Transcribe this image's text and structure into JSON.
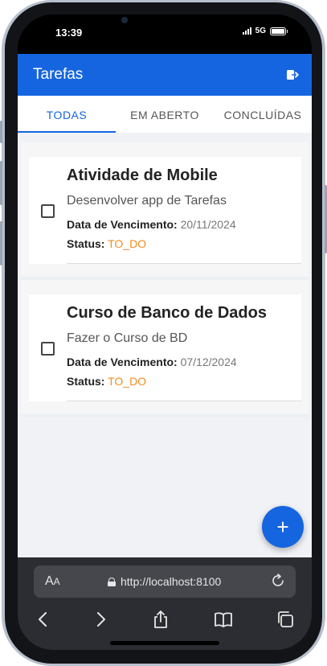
{
  "status_bar": {
    "time": "13:39",
    "network": "5G"
  },
  "app": {
    "title": "Tarefas",
    "accent_color": "#1565e0",
    "header_icon": "logout-icon"
  },
  "tabs": [
    {
      "label": "TODAS",
      "active": true
    },
    {
      "label": "EM ABERTO",
      "active": false
    },
    {
      "label": "CONCLUÍDAS",
      "active": false
    }
  ],
  "tasks": [
    {
      "title": "Atividade de Mobile",
      "description": "Desenvolver app de Tarefas",
      "due_label": "Data de Vencimento:",
      "due_value": "20/11/2024",
      "status_label": "Status:",
      "status_value": "TO_DO",
      "checked": false
    },
    {
      "title": "Curso de Banco de Dados",
      "description": "Fazer o Curso de BD",
      "due_label": "Data de Vencimento:",
      "due_value": "07/12/2024",
      "status_label": "Status:",
      "status_value": "TO_DO",
      "checked": false
    }
  ],
  "fab": {
    "icon": "plus-icon",
    "label": "+"
  },
  "browser": {
    "text_size_big": "A",
    "text_size_small": "A",
    "url": "http://localhost:8100",
    "nav_icons": [
      "back-icon",
      "forward-icon",
      "share-icon",
      "bookmarks-icon",
      "tabs-icon"
    ]
  }
}
